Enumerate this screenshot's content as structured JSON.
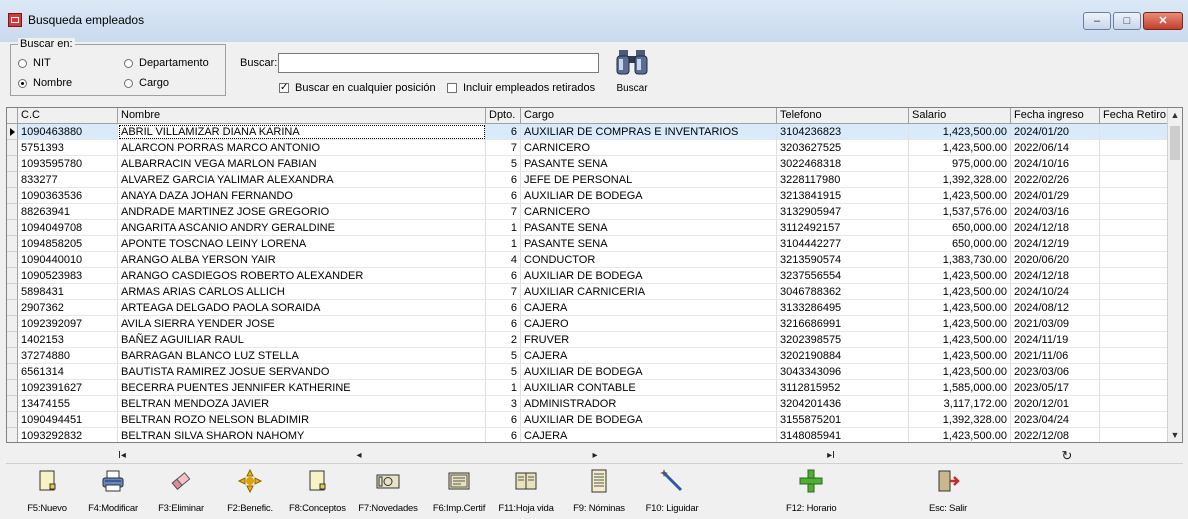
{
  "window": {
    "title": "Busqueda empleados",
    "minimize": "–",
    "maximize": "□",
    "close": "✕"
  },
  "search": {
    "group_label": "Buscar en:",
    "options": {
      "nit": "NIT",
      "nombre": "Nombre",
      "departamento": "Departamento",
      "cargo": "Cargo"
    },
    "selected": "Nombre",
    "buscar_label": "Buscar:",
    "buscar_value": "",
    "check_cualquier": {
      "label": "Buscar en cualquier posición",
      "checked": true
    },
    "check_retirados": {
      "label": "Incluir empleados retirados",
      "checked": false
    },
    "button_label": "Buscar"
  },
  "grid": {
    "columns": [
      "C.C",
      "Nombre",
      "Dpto.",
      "Cargo",
      "Telefono",
      "Salario",
      "Fecha ingreso",
      "Fecha Retiro"
    ],
    "rows": [
      [
        "1090463880",
        "ABRIL VILLAMIZAR DIANA KARINA",
        "6",
        "AUXILIAR DE COMPRAS E INVENTARIOS",
        "3104236823",
        "1,423,500.00",
        "2024/01/20",
        ""
      ],
      [
        "5751393",
        "ALARCON PORRAS MARCO ANTONIO",
        "7",
        "CARNICERO",
        "3203627525",
        "1,423,500.00",
        "2022/06/14",
        ""
      ],
      [
        "1093595780",
        "ALBARRACIN VEGA MARLON FABIAN",
        "5",
        "PASANTE SENA",
        "3022468318",
        "975,000.00",
        "2024/10/16",
        ""
      ],
      [
        "833277",
        "ALVAREZ GARCIA YALIMAR ALEXANDRA",
        "6",
        "JEFE DE PERSONAL",
        "3228117980",
        "1,392,328.00",
        "2022/02/26",
        ""
      ],
      [
        "1090363536",
        "ANAYA DAZA JOHAN FERNANDO",
        "6",
        "AUXILIAR DE BODEGA",
        "3213841915",
        "1,423,500.00",
        "2024/01/29",
        ""
      ],
      [
        "88263941",
        "ANDRADE MARTINEZ JOSE GREGORIO",
        "7",
        "CARNICERO",
        "3132905947",
        "1,537,576.00",
        "2024/03/16",
        ""
      ],
      [
        "1094049708",
        "ANGARITA ASCANIO ANDRY GERALDINE",
        "1",
        "PASANTE SENA",
        "3112492157",
        "650,000.00",
        "2024/12/18",
        ""
      ],
      [
        "1094858205",
        "APONTE TOSCNAO LEINY LORENA",
        "1",
        "PASANTE SENA",
        "3104442277",
        "650,000.00",
        "2024/12/19",
        ""
      ],
      [
        "1090440010",
        "ARANGO ALBA YERSON YAIR",
        "4",
        "CONDUCTOR",
        "3213590574",
        "1,383,730.00",
        "2020/06/20",
        ""
      ],
      [
        "1090523983",
        "ARANGO CASDIEGOS ROBERTO ALEXANDER",
        "6",
        "AUXILIAR DE BODEGA",
        "3237556554",
        "1,423,500.00",
        "2024/12/18",
        ""
      ],
      [
        "5898431",
        "ARMAS ARIAS CARLOS ALLICH",
        "7",
        "AUXILIAR CARNICERIA",
        "3046788362",
        "1,423,500.00",
        "2024/10/24",
        ""
      ],
      [
        "2907362",
        "ARTEAGA DELGADO PAOLA SORAIDA",
        "6",
        "CAJERA",
        "3133286495",
        "1,423,500.00",
        "2024/08/12",
        ""
      ],
      [
        "1092392097",
        "AVILA SIERRA YENDER JOSE",
        "6",
        "CAJERO",
        "3216686991",
        "1,423,500.00",
        "2021/03/09",
        ""
      ],
      [
        "1402153",
        "BAÑEZ AGUILIAR RAUL",
        "2",
        "FRUVER",
        "3202398575",
        "1,423,500.00",
        "2024/11/19",
        ""
      ],
      [
        "37274880",
        "BARRAGAN BLANCO LUZ STELLA",
        "5",
        "CAJERA",
        "3202190884",
        "1,423,500.00",
        "2021/11/06",
        ""
      ],
      [
        "6561314",
        "BAUTISTA RAMIREZ JOSUE SERVANDO",
        "5",
        "AUXILIAR DE BODEGA",
        "3043343096",
        "1,423,500.00",
        "2023/03/06",
        ""
      ],
      [
        "1092391627",
        "BECERRA PUENTES JENNIFER KATHERINE",
        "1",
        "AUXILIAR CONTABLE",
        "3112815952",
        "1,585,000.00",
        "2023/05/17",
        ""
      ],
      [
        "13474155",
        "BELTRAN MENDOZA JAVIER",
        "3",
        "ADMINISTRADOR",
        "3204201436",
        "3,117,172.00",
        "2020/12/01",
        ""
      ],
      [
        "1090494451",
        "BELTRAN ROZO NELSON BLADIMIR",
        "6",
        "AUXILIAR DE BODEGA",
        "3155875201",
        "1,392,328.00",
        "2023/04/24",
        ""
      ],
      [
        "1093292832",
        "BELTRAN SILVA SHARON NAHOMY",
        "6",
        "CAJERA",
        "3148085941",
        "1,423,500.00",
        "2022/12/08",
        ""
      ]
    ]
  },
  "navigator": {
    "first": "I◂",
    "prior": "◂",
    "next": "▸",
    "last": "▸I",
    "refresh": "↻"
  },
  "toolbar": [
    {
      "label": "F5:Nuevo",
      "icon": "new-document-icon"
    },
    {
      "label": "F4:Modificar",
      "icon": "printer-edit-icon"
    },
    {
      "label": "F3:Eliminar",
      "icon": "eraser-icon"
    },
    {
      "label": "F2:Benefic.",
      "icon": "benefits-icon"
    },
    {
      "label": "F8:Conceptos",
      "icon": "document-icon"
    },
    {
      "label": "F7:Novedades",
      "icon": "money-icon"
    },
    {
      "label": "F6:Imp.Certif",
      "icon": "certificate-icon"
    },
    {
      "label": "F11:Hoja vida",
      "icon": "book-icon"
    },
    {
      "label": "F9: Nóminas",
      "icon": "payroll-icon"
    },
    {
      "label": "F10: Liguidar",
      "icon": "magic-wand-icon"
    },
    {
      "label": "F12: Horario",
      "icon": "plus-icon"
    },
    {
      "label": "Esc: Salir",
      "icon": "exit-door-icon"
    }
  ],
  "colors": {
    "selected_row": "#d9ebfb",
    "title_bar": "#dbe8f6",
    "close_button": "#c2402c"
  }
}
